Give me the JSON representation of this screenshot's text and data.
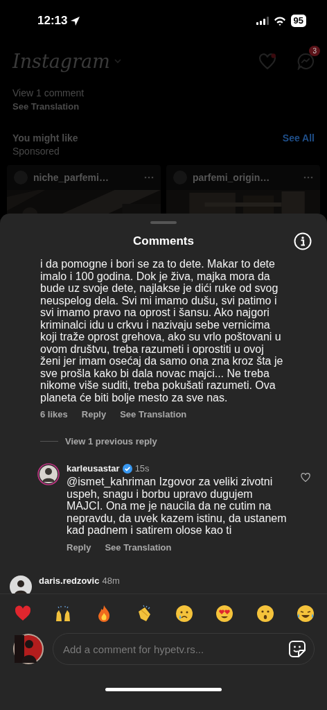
{
  "status_bar": {
    "time": "12:13",
    "battery": "95"
  },
  "feed": {
    "logo": "Instagram",
    "messages_badge": "3",
    "lines": [
      "View 1 comment",
      "See Translation"
    ],
    "section_title": "You might like",
    "section_subtitle": "Sponsored",
    "see_all": "See All",
    "cards": [
      {
        "username": "niche_parfemi…"
      },
      {
        "username": "parfemi_origin…"
      }
    ]
  },
  "sheet": {
    "title": "Comments"
  },
  "comment": {
    "text": "i da pomogne i bori se za to dete. Makar to dete imalo i 100 godina. Dok je živa, majka mora da bude uz svoje dete, najlakse je dići ruke od svog neuspelog dela. Svi mi imamo dušu, svi patimo i svi imamo pravo na oprost i šansu. Ako najgori kriminalci idu u crkvu i nazivaju sebe vernicima koji traže oprost grehova, ako su vrlo poštovani u ovom društvu, treba razumeti i oprostiti u ovoj ženi jer imam osećaj da samo ona zna kroz šta je sve prošla kako bi dala novac majci... Ne treba nikome više suditi, treba pokušati razumeti. Ova planeta će biti bolje mesto za sve nas.",
    "likes": "6 likes",
    "reply": "Reply",
    "translate": "See Translation"
  },
  "view_replies": "View 1 previous reply",
  "replies": [
    {
      "username": "karleusastar",
      "verified": true,
      "time": "15s",
      "text": "@ismet_kahriman Izgovor za veliki zivotni uspeh, snagu i borbu upravo dugujem MAJCI. Ona me je naucila da ne cutim na nepravdu, da uvek kazem istinu, da ustanem kad padnem i satirem olose kao ti",
      "reply": "Reply",
      "translate": "See Translation"
    }
  ],
  "next_comment": {
    "username": "daris.redzovic",
    "time": "48m"
  },
  "composer": {
    "placeholder": "Add a comment for hypetv.rs..."
  }
}
